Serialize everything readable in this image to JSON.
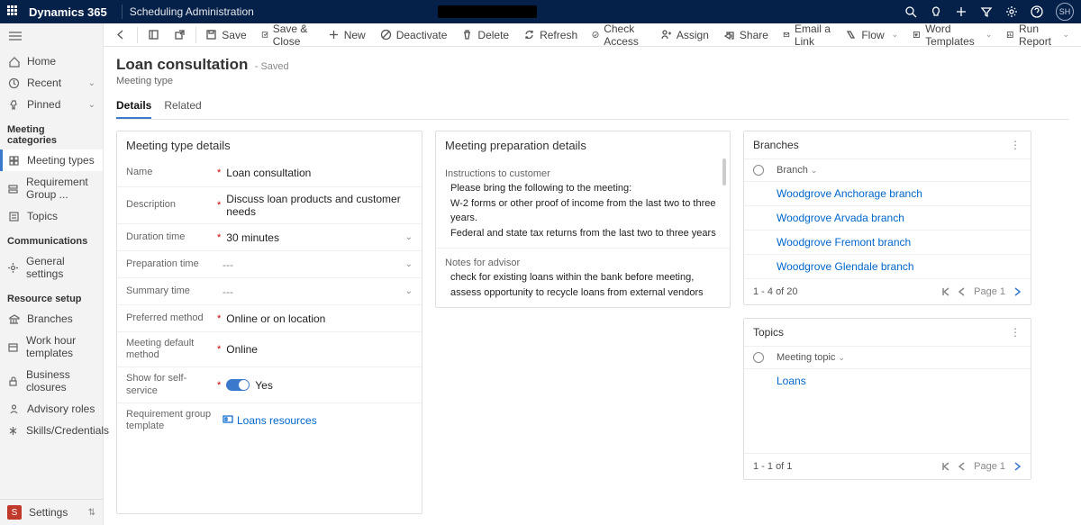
{
  "topbar": {
    "brand": "Dynamics 365",
    "area": "Scheduling Administration",
    "avatar": "SH"
  },
  "sidebar": {
    "nav": [
      {
        "icon": "home",
        "label": "Home"
      },
      {
        "icon": "clock",
        "label": "Recent",
        "chev": true
      },
      {
        "icon": "pin",
        "label": "Pinned",
        "chev": true
      }
    ],
    "groups": [
      {
        "title": "Meeting categories",
        "items": [
          {
            "icon": "grid",
            "label": "Meeting types",
            "active": true
          },
          {
            "icon": "group",
            "label": "Requirement Group ..."
          },
          {
            "icon": "topic",
            "label": "Topics"
          }
        ]
      },
      {
        "title": "Communications",
        "items": [
          {
            "icon": "gear",
            "label": "General settings"
          }
        ]
      },
      {
        "title": "Resource setup",
        "items": [
          {
            "icon": "bank",
            "label": "Branches"
          },
          {
            "icon": "cal",
            "label": "Work hour templates"
          },
          {
            "icon": "lock",
            "label": "Business closures"
          },
          {
            "icon": "adv",
            "label": "Advisory roles"
          },
          {
            "icon": "skill",
            "label": "Skills/Credentials"
          }
        ]
      }
    ],
    "footer": {
      "badge": "S",
      "label": "Settings"
    }
  },
  "cmds": [
    {
      "ico": "back"
    },
    {
      "sep": true
    },
    {
      "ico": "panel"
    },
    {
      "ico": "popout"
    },
    {
      "sep": true
    },
    {
      "ico": "save",
      "label": "Save"
    },
    {
      "ico": "saveclose",
      "label": "Save & Close"
    },
    {
      "ico": "plus",
      "label": "New"
    },
    {
      "ico": "deact",
      "label": "Deactivate"
    },
    {
      "ico": "del",
      "label": "Delete"
    },
    {
      "ico": "refresh",
      "label": "Refresh"
    },
    {
      "ico": "check",
      "label": "Check Access"
    },
    {
      "ico": "assign",
      "label": "Assign"
    },
    {
      "ico": "share",
      "label": "Share"
    },
    {
      "ico": "mail",
      "label": "Email a Link"
    },
    {
      "ico": "flow",
      "label": "Flow",
      "dd": true
    },
    {
      "ico": "word",
      "label": "Word Templates",
      "dd": true
    },
    {
      "ico": "report",
      "label": "Run Report",
      "dd": true
    }
  ],
  "header": {
    "title": "Loan consultation",
    "state": "- Saved",
    "subtitle": "Meeting type",
    "tabs": [
      "Details",
      "Related"
    ],
    "active_tab": 0
  },
  "details": {
    "section_title": "Meeting type details",
    "fields": [
      {
        "label": "Name",
        "req": true,
        "value": "Loan consultation"
      },
      {
        "label": "Description",
        "req": true,
        "value": "Discuss loan products and customer needs"
      },
      {
        "label": "Duration time",
        "req": true,
        "value": "30 minutes",
        "dd": true
      },
      {
        "label": "Preparation time",
        "value": "---",
        "dd": true
      },
      {
        "label": "Summary time",
        "value": "---",
        "dd": true
      },
      {
        "label": "Preferred method",
        "req": true,
        "value": "Online or on location"
      },
      {
        "label": "Meeting default method",
        "req": true,
        "value": "Online"
      },
      {
        "label": "Show for self-service",
        "req": true,
        "toggle": true,
        "value": "Yes"
      },
      {
        "label": "Requirement group template",
        "lookup": true,
        "value": "Loans resources"
      }
    ]
  },
  "prep": {
    "section_title": "Meeting preparation details",
    "instr_label": "Instructions to customer",
    "instr_lines": [
      "Please bring the following to the meeting:",
      "W-2 forms or other proof of income from the last two to three years.",
      "Federal and state tax returns from the last two to three years"
    ],
    "notes_label": "Notes for advisor",
    "notes_text": "check for existing loans within the bank before meeting, assess opportunity to recycle loans from external vendors"
  },
  "branches": {
    "title": "Branches",
    "col": "Branch",
    "rows": [
      "Woodgrove Anchorage branch",
      "Woodgrove Arvada branch",
      "Woodgrove Fremont branch",
      "Woodgrove Glendale branch"
    ],
    "count": "1 - 4 of 20",
    "page": "Page 1"
  },
  "topics": {
    "title": "Topics",
    "col": "Meeting topic",
    "rows": [
      "Loans"
    ],
    "count": "1 - 1 of 1",
    "page": "Page 1"
  }
}
